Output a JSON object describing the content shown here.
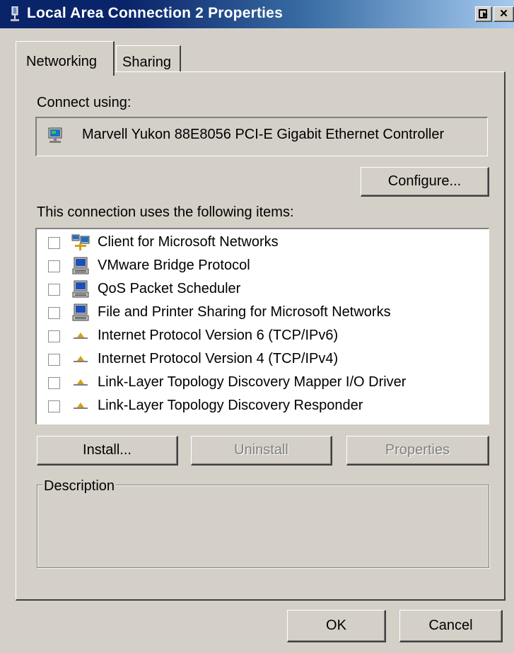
{
  "window": {
    "title": "Local Area Connection 2 Properties"
  },
  "titlebar_buttons": {
    "help_icon": "help-arrow-icon",
    "close_glyph": "✕"
  },
  "tabs": [
    {
      "label": "Networking",
      "active": true
    },
    {
      "label": "Sharing",
      "active": false
    }
  ],
  "connect": {
    "label": "Connect using:",
    "adapter": "Marvell Yukon 88E8056 PCI-E Gigabit Ethernet Controller",
    "adapter_icon": "network-adapter-icon",
    "configure_label": "Configure..."
  },
  "items_header": "This connection uses the following items:",
  "items": [
    {
      "label": "Client for Microsoft Networks",
      "checked": false,
      "icon": "network-client-icon"
    },
    {
      "label": "VMware Bridge Protocol",
      "checked": false,
      "icon": "computer-icon"
    },
    {
      "label": "QoS Packet Scheduler",
      "checked": false,
      "icon": "computer-icon"
    },
    {
      "label": "File and Printer Sharing for Microsoft Networks",
      "checked": false,
      "icon": "computer-icon"
    },
    {
      "label": "Internet Protocol Version 6 (TCP/IPv6)",
      "checked": false,
      "icon": "protocol-icon"
    },
    {
      "label": "Internet Protocol Version 4 (TCP/IPv4)",
      "checked": false,
      "icon": "protocol-icon"
    },
    {
      "label": "Link-Layer Topology Discovery Mapper I/O Driver",
      "checked": false,
      "icon": "protocol-icon"
    },
    {
      "label": "Link-Layer Topology Discovery Responder",
      "checked": false,
      "icon": "protocol-icon"
    }
  ],
  "buttons": {
    "install": "Install...",
    "uninstall": "Uninstall",
    "properties": "Properties",
    "ok": "OK",
    "cancel": "Cancel"
  },
  "description": {
    "label": "Description",
    "text": ""
  },
  "colors": {
    "titlebar_start": "#0a246a",
    "titlebar_end": "#a6caf0",
    "face": "#d4d0c8",
    "disabled_text": "#808080"
  }
}
